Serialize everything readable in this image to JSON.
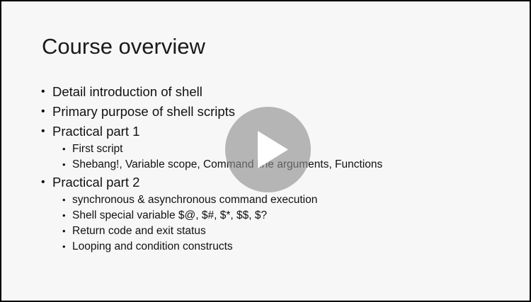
{
  "slide": {
    "title": "Course overview",
    "bullets": [
      {
        "text": "Detail introduction of shell",
        "sub": []
      },
      {
        "text": "Primary purpose of shell scripts",
        "sub": []
      },
      {
        "text": "Practical part 1",
        "sub": [
          "First script",
          "Shebang!, Variable scope, Command line arguments, Functions"
        ]
      },
      {
        "text": "Practical part 2",
        "sub": [
          "synchronous & asynchronous command execution",
          "Shell special variable $@, $#, $*, $$, $?",
          "Return code and exit status",
          "Looping and condition constructs"
        ]
      }
    ]
  },
  "player": {
    "play_icon": "play-icon",
    "overlay_color": "#8c8c8c"
  }
}
